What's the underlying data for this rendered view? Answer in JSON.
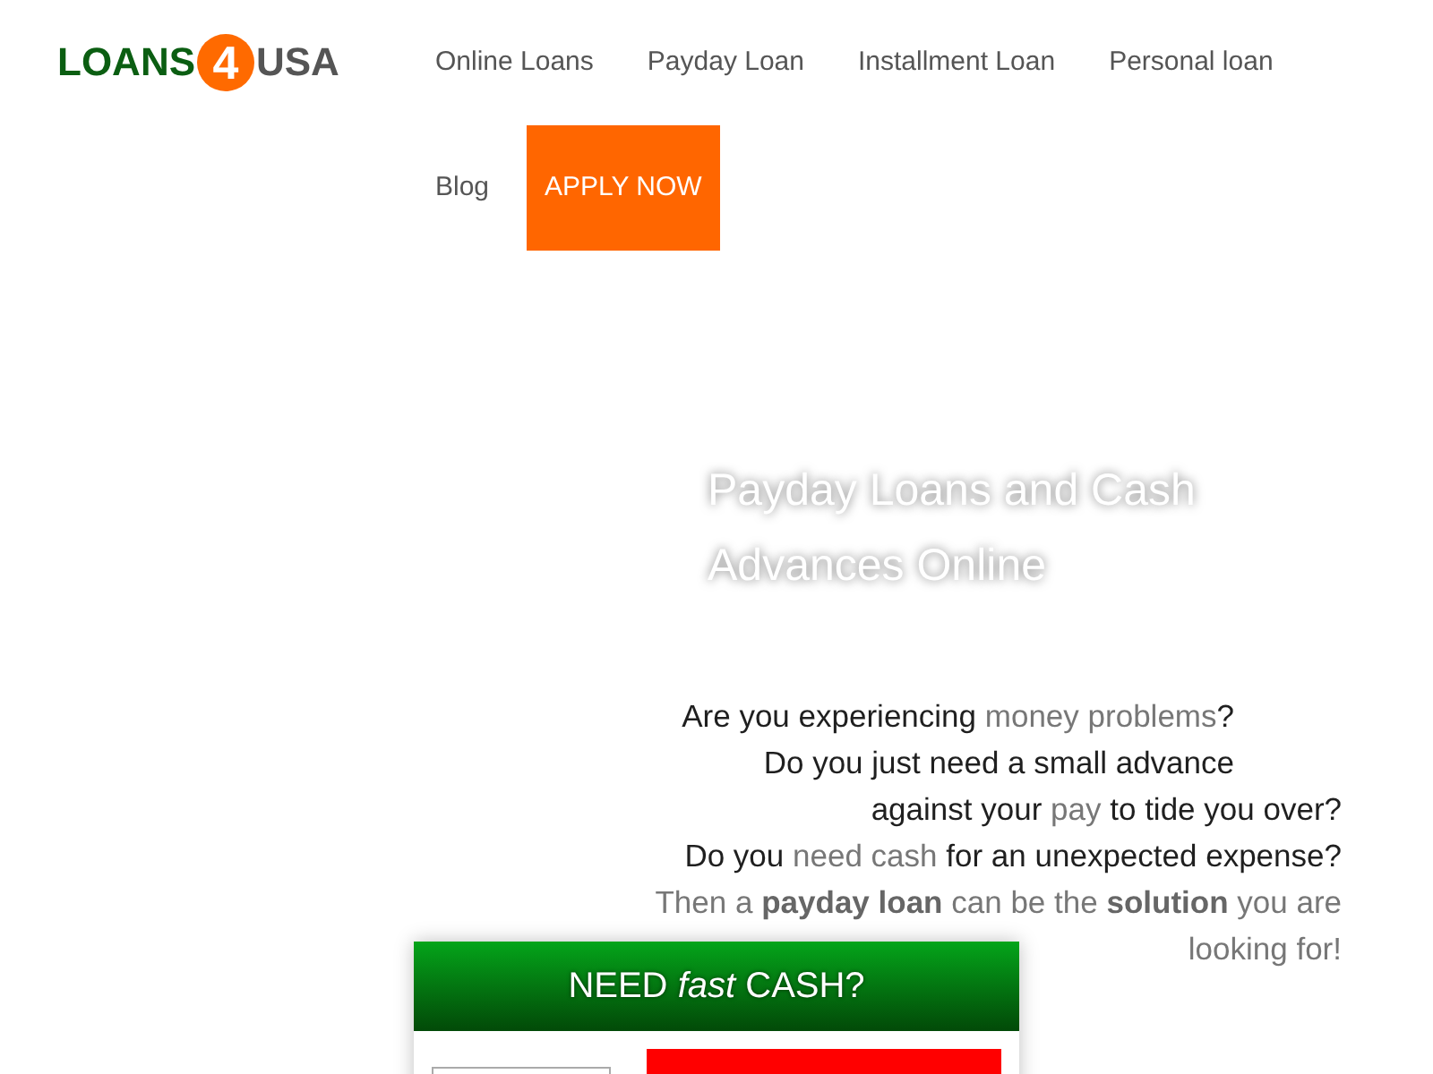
{
  "logo": {
    "left": "LOANS",
    "digit": "4",
    "right": "USA"
  },
  "nav": {
    "links": [
      "Online Loans",
      "Payday Loan",
      "Installment Loan",
      "Personal loan",
      "Blog"
    ],
    "cta": "APPLY NOW"
  },
  "hero": {
    "title": "Payday Loans and Cash Advances Online",
    "lines": [
      {
        "segments": [
          {
            "text": "Are you experiencing ",
            "muted": false
          },
          {
            "text": "money problems",
            "muted": true
          },
          {
            "text": "?",
            "muted": false
          }
        ]
      },
      {
        "segments": [
          {
            "text": "Do you just need a small advance",
            "muted": false
          }
        ]
      },
      {
        "segments": [
          {
            "text": "against your ",
            "muted": false
          },
          {
            "text": "pay",
            "muted": true
          },
          {
            "text": " to tide you over?",
            "muted": false
          }
        ]
      },
      {
        "segments": [
          {
            "text": "Do you ",
            "muted": false
          },
          {
            "text": "need cash",
            "muted": true
          },
          {
            "text": " for an unexpected expense?",
            "muted": false
          }
        ]
      },
      {
        "segments": [
          {
            "text": "Then a **payday loan** can be the **solution** you are",
            "muted": true
          }
        ]
      },
      {
        "segments": [
          {
            "text": "looking for!",
            "muted": true
          }
        ]
      }
    ]
  },
  "cash_form": {
    "title": "NEED *fast* CASH?"
  }
}
